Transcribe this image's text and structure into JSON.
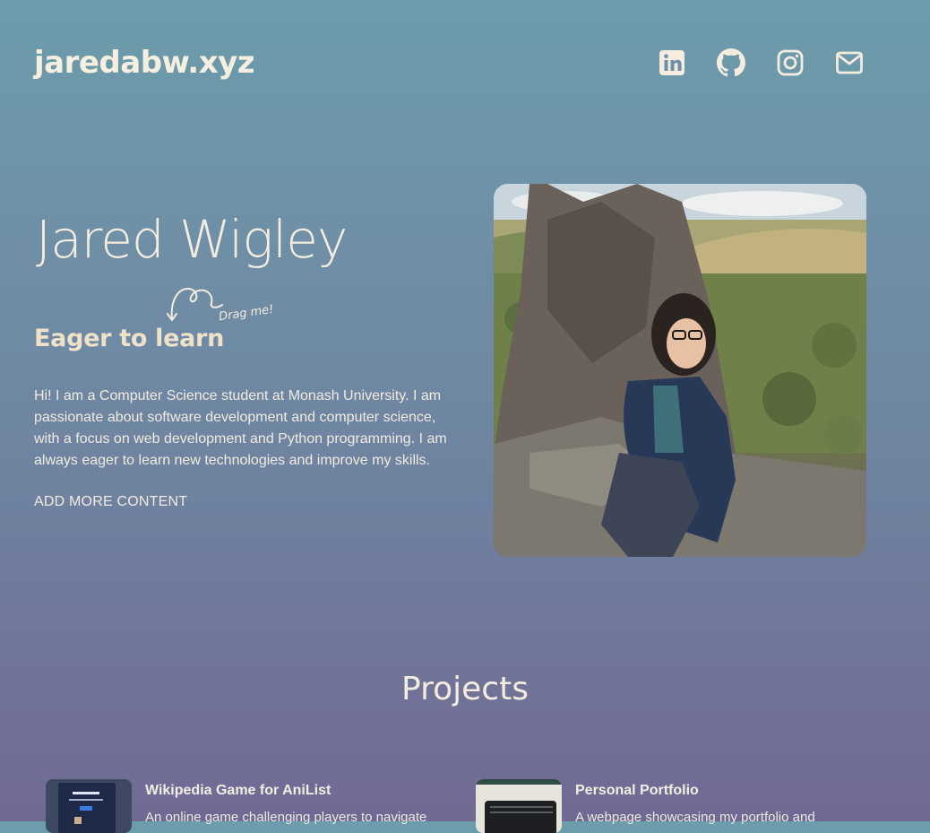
{
  "header": {
    "site_title": "jaredabw.xyz",
    "social_links": [
      {
        "icon": "linkedin-icon"
      },
      {
        "icon": "github-icon"
      },
      {
        "icon": "instagram-icon"
      },
      {
        "icon": "email-icon"
      }
    ]
  },
  "hero": {
    "name": "Jared Wigley",
    "tagline": "Eager to learn",
    "drag_hint": "Drag me!",
    "bio": "Hi! I am a Computer Science student at Monash University. I am passionate about software development and computer science, with a focus on web development and Python programming. I am always eager to learn new technologies and improve my skills.",
    "more_link": "ADD MORE CONTENT"
  },
  "projects": {
    "heading": "Projects",
    "items": [
      {
        "title": "Wikipedia Game for AniList",
        "description": "An online game challenging players to navigate"
      },
      {
        "title": "Personal Portfolio",
        "description": "A webpage showcasing my portfolio and"
      }
    ]
  },
  "colors": {
    "text_cream": "#f3ecdf",
    "tagline": "#efe2c9",
    "bg_top": "#6b9dac",
    "bg_bottom": "#6f6a94"
  }
}
